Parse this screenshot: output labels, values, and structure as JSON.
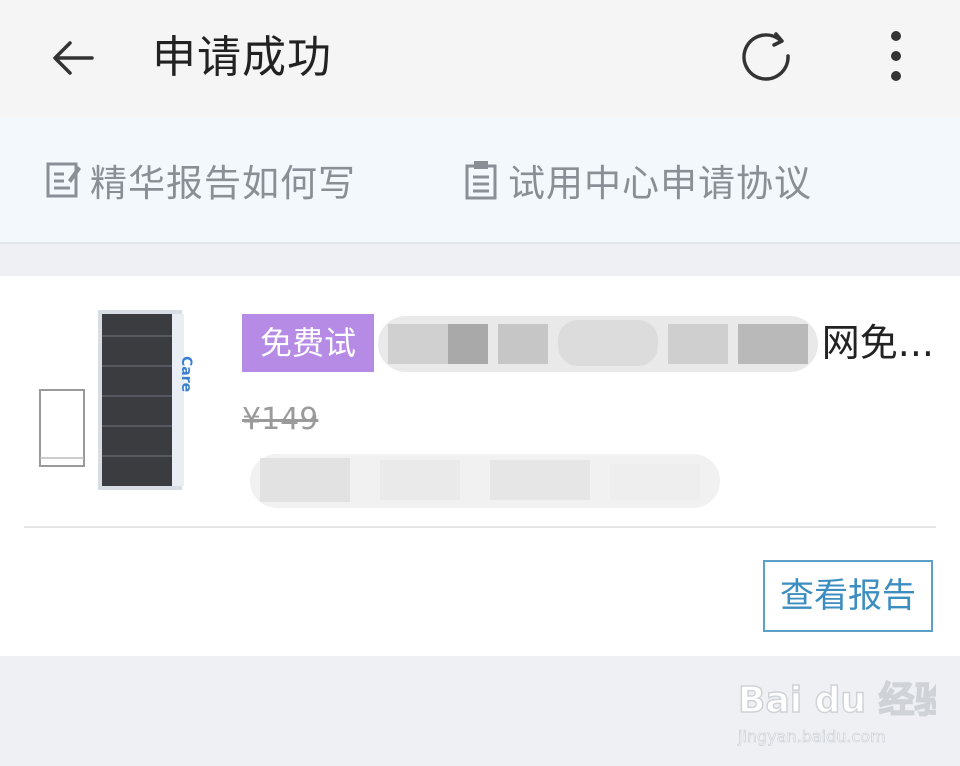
{
  "header": {
    "title": "申请成功",
    "back_icon": "arrow-left-icon",
    "refresh_icon": "refresh-icon",
    "more_icon": "more-vertical-icon"
  },
  "links": [
    {
      "label": "精华报告如何写",
      "icon": "edit-document-icon"
    },
    {
      "label": "试用中心申请协议",
      "icon": "clipboard-icon"
    }
  ],
  "product": {
    "badge": "免费试",
    "name_visible": "网免...",
    "price": "¥149",
    "view_report_label": "查看报告",
    "thumbnail_text": "Care"
  },
  "watermark": {
    "brand": "Bai du 经验",
    "url": "jingyan.baidu.com"
  },
  "colors": {
    "badge_bg": "#b58be6",
    "button_border": "#5aa0c8",
    "button_text": "#3d8ec0",
    "link_text": "#8a8f96"
  }
}
